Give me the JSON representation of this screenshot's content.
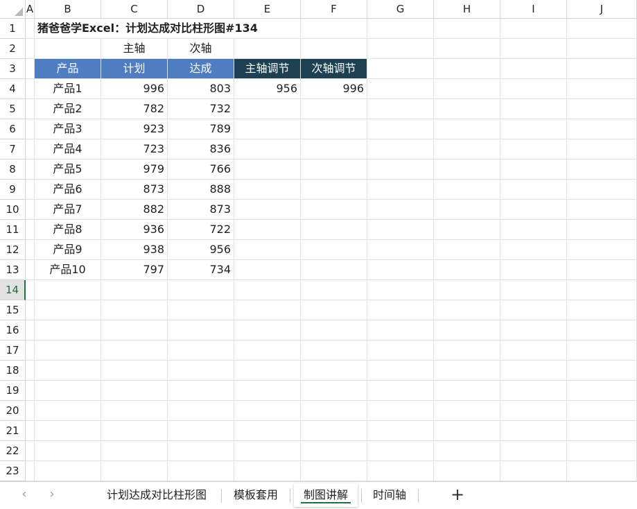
{
  "columns": [
    "A",
    "B",
    "C",
    "D",
    "E",
    "F",
    "G",
    "H",
    "I",
    "J"
  ],
  "rows": [
    "1",
    "2",
    "3",
    "4",
    "5",
    "6",
    "7",
    "8",
    "9",
    "10",
    "11",
    "12",
    "13",
    "14",
    "15",
    "16",
    "17",
    "18",
    "19",
    "20",
    "21",
    "22",
    "23"
  ],
  "selected_row": "14",
  "title": "猪爸爸学Excel：计划达成对比柱形图#134",
  "axis_labels": {
    "primary": "主轴",
    "secondary": "次轴"
  },
  "table": {
    "headers": {
      "product": "产品",
      "plan": "计划",
      "actual": "达成",
      "primary_adjust": "主轴调节",
      "secondary_adjust": "次轴调节"
    },
    "rows": [
      {
        "product": "产品1",
        "plan": "996",
        "actual": "803",
        "primary_adjust": "956",
        "secondary_adjust": "996"
      },
      {
        "product": "产品2",
        "plan": "782",
        "actual": "732",
        "primary_adjust": "",
        "secondary_adjust": ""
      },
      {
        "product": "产品3",
        "plan": "923",
        "actual": "789",
        "primary_adjust": "",
        "secondary_adjust": ""
      },
      {
        "product": "产品4",
        "plan": "723",
        "actual": "836",
        "primary_adjust": "",
        "secondary_adjust": ""
      },
      {
        "product": "产品5",
        "plan": "979",
        "actual": "766",
        "primary_adjust": "",
        "secondary_adjust": ""
      },
      {
        "product": "产品6",
        "plan": "873",
        "actual": "888",
        "primary_adjust": "",
        "secondary_adjust": ""
      },
      {
        "product": "产品7",
        "plan": "882",
        "actual": "873",
        "primary_adjust": "",
        "secondary_adjust": ""
      },
      {
        "product": "产品8",
        "plan": "936",
        "actual": "722",
        "primary_adjust": "",
        "secondary_adjust": ""
      },
      {
        "product": "产品9",
        "plan": "938",
        "actual": "956",
        "primary_adjust": "",
        "secondary_adjust": ""
      },
      {
        "product": "产品10",
        "plan": "797",
        "actual": "734",
        "primary_adjust": "",
        "secondary_adjust": ""
      }
    ]
  },
  "colors": {
    "header_blue": "#4f7dc1",
    "header_dark": "#1d4152",
    "active_tab_accent": "#1e7145"
  },
  "sheet_tabs": {
    "nav_prev_icon": "chevron-left-icon",
    "nav_next_icon": "chevron-right-icon",
    "prev_glyph": "‹",
    "next_glyph": "›",
    "tabs": [
      "计划达成对比柱形图",
      "模板套用",
      "制图讲解",
      "时间轴"
    ],
    "active_tab": "制图讲解",
    "add_icon": "plus-icon",
    "add_glyph": "+"
  }
}
